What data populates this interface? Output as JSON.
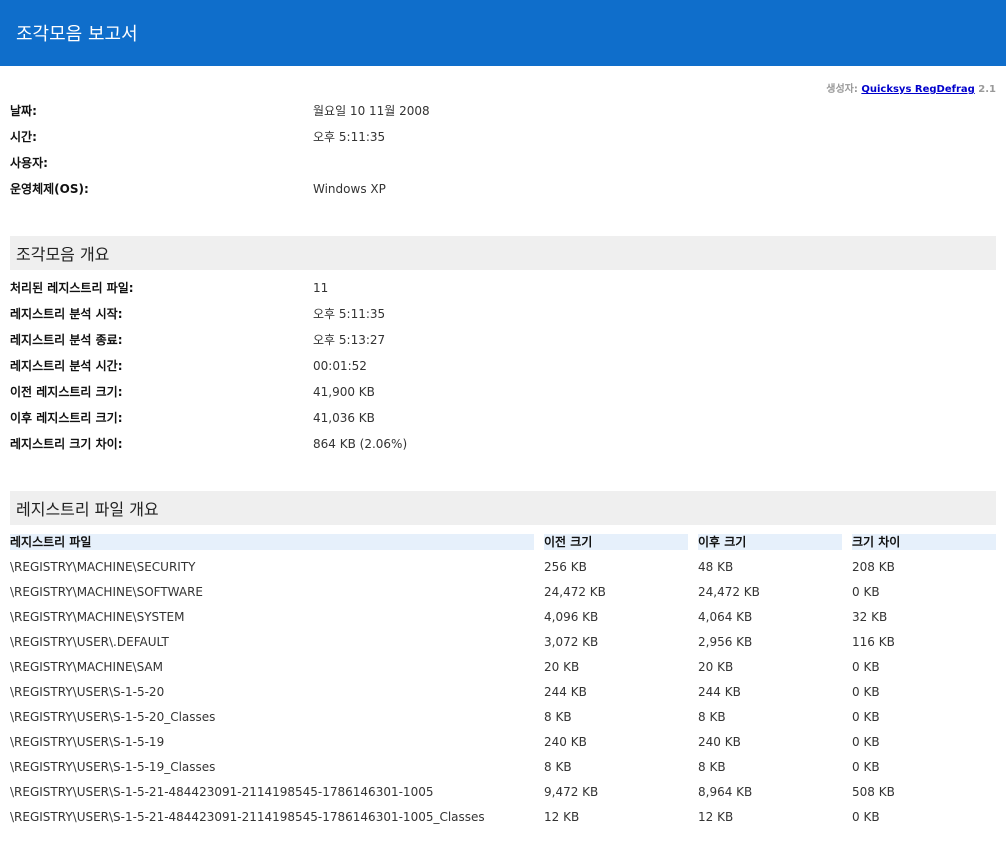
{
  "header": {
    "title": "조각모음 보고서"
  },
  "generated": {
    "label": "생성자:",
    "link": "Quicksys RegDefrag",
    "version": "2.1"
  },
  "info": [
    {
      "key": "날짜:",
      "value": "월요일 10 11월 2008"
    },
    {
      "key": "시간:",
      "value": "오후 5:11:35"
    },
    {
      "key": "사용자:",
      "value": ""
    },
    {
      "key": "운영체제(OS):",
      "value": "Windows XP"
    }
  ],
  "summary": {
    "title": "조각모음 개요",
    "rows": [
      {
        "key": "처리된 레지스트리 파일:",
        "value": "11"
      },
      {
        "key": "레지스트리 분석 시작:",
        "value": "오후 5:11:35"
      },
      {
        "key": "레지스트리 분석 종료:",
        "value": "오후 5:13:27"
      },
      {
        "key": "레지스트리 분석 시간:",
        "value": "00:01:52"
      },
      {
        "key": "이전 레지스트리 크기:",
        "value": "41,900 KB"
      },
      {
        "key": "이후 레지스트리 크기:",
        "value": "41,036 KB"
      },
      {
        "key": "레지스트리 크기 차이:",
        "value": "864 KB (2.06%)"
      }
    ]
  },
  "files": {
    "title": "레지스트리 파일 개요",
    "columns": [
      "레지스트리 파일",
      "이전 크기",
      "이후 크기",
      "크기 차이"
    ],
    "rows": [
      [
        "\\REGISTRY\\MACHINE\\SECURITY",
        "256 KB",
        "48 KB",
        "208 KB"
      ],
      [
        "\\REGISTRY\\MACHINE\\SOFTWARE",
        "24,472 KB",
        "24,472 KB",
        "0 KB"
      ],
      [
        "\\REGISTRY\\MACHINE\\SYSTEM",
        "4,096 KB",
        "4,064 KB",
        "32 KB"
      ],
      [
        "\\REGISTRY\\USER\\.DEFAULT",
        "3,072 KB",
        "2,956 KB",
        "116 KB"
      ],
      [
        "\\REGISTRY\\MACHINE\\SAM",
        "20 KB",
        "20 KB",
        "0 KB"
      ],
      [
        "\\REGISTRY\\USER\\S-1-5-20",
        "244 KB",
        "244 KB",
        "0 KB"
      ],
      [
        "\\REGISTRY\\USER\\S-1-5-20_Classes",
        "8 KB",
        "8 KB",
        "0 KB"
      ],
      [
        "\\REGISTRY\\USER\\S-1-5-19",
        "240 KB",
        "240 KB",
        "0 KB"
      ],
      [
        "\\REGISTRY\\USER\\S-1-5-19_Classes",
        "8 KB",
        "8 KB",
        "0 KB"
      ],
      [
        "\\REGISTRY\\USER\\S-1-5-21-484423091-2114198545-1786146301-1005",
        "9,472 KB",
        "8,964 KB",
        "508 KB"
      ],
      [
        "\\REGISTRY\\USER\\S-1-5-21-484423091-2114198545-1786146301-1005_Classes",
        "12 KB",
        "12 KB",
        "0 KB"
      ]
    ]
  }
}
